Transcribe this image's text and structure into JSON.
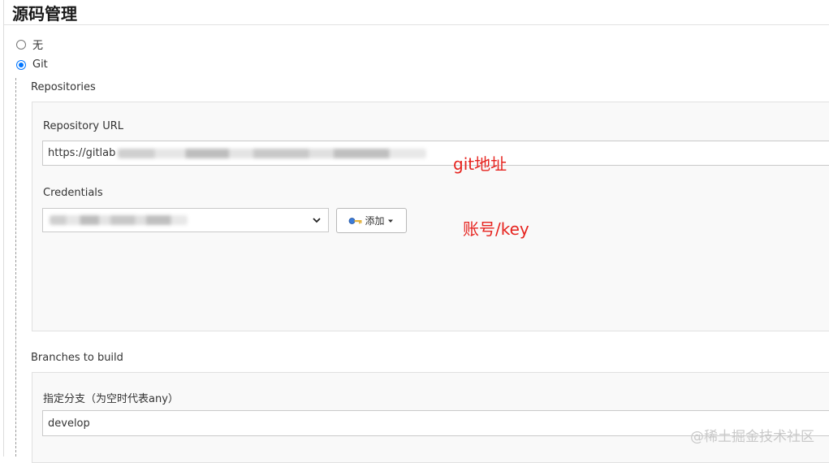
{
  "section": {
    "title": "源码管理"
  },
  "scm_options": [
    {
      "label": "无",
      "selected": false
    },
    {
      "label": "Git",
      "selected": true
    }
  ],
  "repositories": {
    "heading": "Repositories",
    "url_label": "Repository URL",
    "url_value": "https://gitlab",
    "credentials_label": "Credentials",
    "add_button_label": "添加"
  },
  "branches": {
    "heading": "Branches to build",
    "specifier_label": "指定分支（为空时代表any）",
    "specifier_value": "develop"
  },
  "annotations": {
    "url_note": "git地址",
    "credentials_note": "账号/key"
  },
  "watermark": "@稀土掘金技术社区",
  "colors": {
    "radio_accent": "#0075ff",
    "annotation": "#e6231e"
  },
  "icons": {
    "add_button": "key-icon",
    "add_dropdown": "caret-down-icon",
    "select": "chevron-down-icon"
  }
}
